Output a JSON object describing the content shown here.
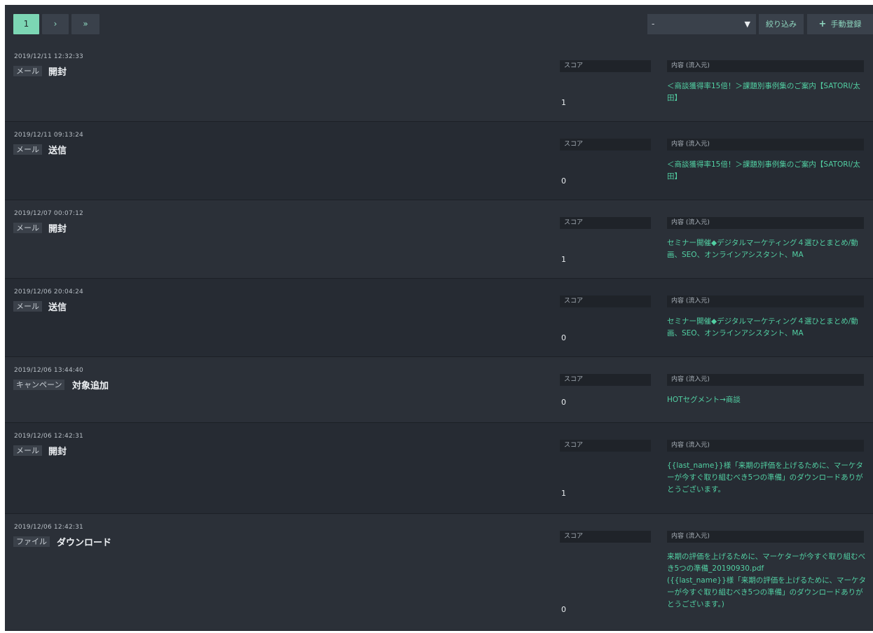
{
  "pagination": {
    "current": "1",
    "next": "›",
    "last": "»"
  },
  "filter": {
    "selected": "-",
    "caret": "▼",
    "filter_label": "絞り込み",
    "register_label": "手動登録",
    "register_icon": "+"
  },
  "labels": {
    "score": "スコア",
    "content": "内容 (流入元)"
  },
  "colors": {
    "accent": "#7cd6b4",
    "content_text": "#52d0a3"
  },
  "rows": [
    {
      "timestamp": "2019/12/11 12:32:33",
      "kind": "メール",
      "action": "開封",
      "score": "1",
      "content": [
        "＜商談獲得率15倍！＞課題別事例集のご案内【SATORI/太田】"
      ]
    },
    {
      "timestamp": "2019/12/11 09:13:24",
      "kind": "メール",
      "action": "送信",
      "score": "0",
      "content": [
        "＜商談獲得率15倍！＞課題別事例集のご案内【SATORI/太田】"
      ]
    },
    {
      "timestamp": "2019/12/07 00:07:12",
      "kind": "メール",
      "action": "開封",
      "score": "1",
      "content": [
        "セミナー開催◆デジタルマーケティング４選ひとまとめ/動画、SEO、オンラインアシスタント、MA"
      ]
    },
    {
      "timestamp": "2019/12/06 20:04:24",
      "kind": "メール",
      "action": "送信",
      "score": "0",
      "content": [
        "セミナー開催◆デジタルマーケティング４選ひとまとめ/動画、SEO、オンラインアシスタント、MA"
      ]
    },
    {
      "timestamp": "2019/12/06 13:44:40",
      "kind": "キャンペーン",
      "action": "対象追加",
      "score": "0",
      "content": [
        "HOTセグメント→商談"
      ]
    },
    {
      "timestamp": "2019/12/06 12:42:31",
      "kind": "メール",
      "action": "開封",
      "score": "1",
      "content": [
        "{{last_name}}様「来期の評価を上げるために、マーケターが今すぐ取り組むべき5つの準備」のダウンロードありがとうございます。"
      ]
    },
    {
      "timestamp": "2019/12/06 12:42:31",
      "kind": "ファイル",
      "action": "ダウンロード",
      "score": "0",
      "content": [
        "来期の評価を上げるために、マーケターが今すぐ取り組むべき5つの準備_20190930.pdf",
        "({{last_name}}様「来期の評価を上げるために、マーケターが今すぐ取り組むべき5つの準備」のダウンロードありがとうございます。)"
      ]
    }
  ]
}
